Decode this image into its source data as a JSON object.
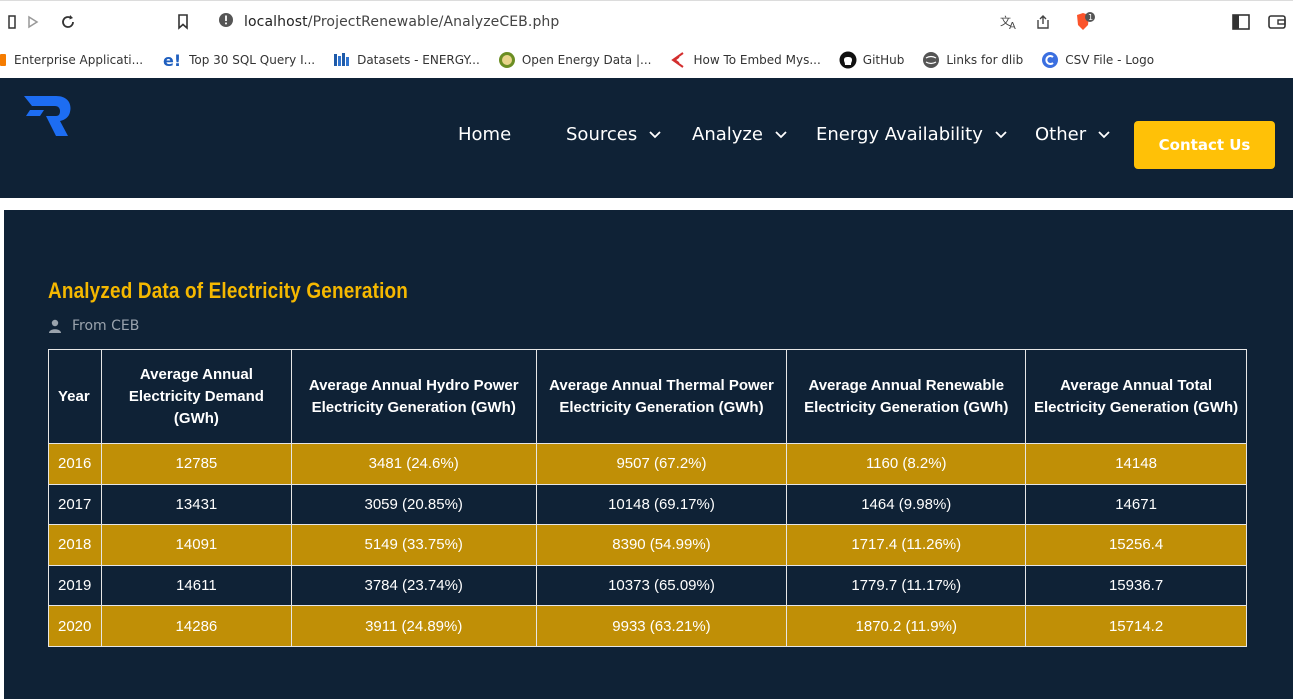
{
  "browser": {
    "url_host": "localhost",
    "url_path": "/ProjectRenewable/AnalyzeCEB.php",
    "extension_badge": "1"
  },
  "bookmarks": [
    {
      "label": "Enterprise Applicati...",
      "icon": "orange-square-icon",
      "color": "#f57c00"
    },
    {
      "label": "Top 30 SQL Query I...",
      "icon_text": "e!",
      "icon": "e-icon",
      "color": "#1f5fbf"
    },
    {
      "label": "Datasets - ENERGY...",
      "icon": "book-icon",
      "color": "#1e5aa8"
    },
    {
      "label": "Open Energy Data |...",
      "icon": "seal-icon",
      "color": "#6b8e23"
    },
    {
      "label": "How To Embed Mys...",
      "icon": "arrow-logo-icon",
      "color": "#d32f2f"
    },
    {
      "label": "GitHub",
      "icon": "github-icon",
      "color": "#111111"
    },
    {
      "label": "Links for dlib",
      "icon": "globe-icon",
      "color": "#555555"
    },
    {
      "label": "CSV File - Logo",
      "icon": "c-logo-icon",
      "color": "#3b6fe0"
    }
  ],
  "header": {
    "nav": [
      {
        "label": "Home",
        "dropdown": false
      },
      {
        "label": "Sources",
        "dropdown": true
      },
      {
        "label": "Analyze",
        "dropdown": true
      },
      {
        "label": "Energy Availability",
        "dropdown": true
      },
      {
        "label": "Other",
        "dropdown": true
      }
    ],
    "contact_label": "Contact Us"
  },
  "content": {
    "title": "Analyzed Data of Electricity Generation",
    "source": "From CEB",
    "table": {
      "headers": [
        "Year",
        "Average Annual Electricity Demand (GWh)",
        "Average Annual Hydro Power Electricity Generation (GWh)",
        "Average Annual Thermal Power Electricity Generation (GWh)",
        "Average Annual Renewable Electricity Generation (GWh)",
        "Average Annual Total Electricity Generation (GWh)"
      ],
      "rows": [
        [
          "2016",
          "12785",
          "3481 (24.6%)",
          "9507 (67.2%)",
          "1160 (8.2%)",
          "14148"
        ],
        [
          "2017",
          "13431",
          "3059 (20.85%)",
          "10148 (69.17%)",
          "1464 (9.98%)",
          "14671"
        ],
        [
          "2018",
          "14091",
          "5149 (33.75%)",
          "8390 (54.99%)",
          "1717.4 (11.26%)",
          "15256.4"
        ],
        [
          "2019",
          "14611",
          "3784 (23.74%)",
          "10373 (65.09%)",
          "1779.7 (11.17%)",
          "15936.7"
        ],
        [
          "2020",
          "14286",
          "3911 (24.89%)",
          "9933 (63.21%)",
          "1870.2 (11.9%)",
          "15714.2"
        ]
      ]
    }
  },
  "colors": {
    "navy": "#0f2236",
    "gold_row": "#c08f06",
    "title_gold": "#f5b800",
    "button_yellow": "#ffc107"
  }
}
